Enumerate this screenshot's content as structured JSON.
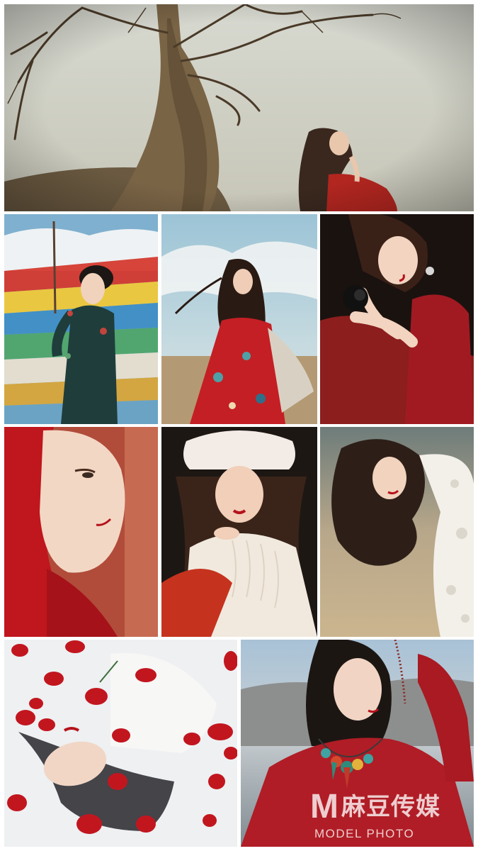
{
  "collage": {
    "photos": [
      {
        "subject": "Woman in red dress leaning back beside a bare twisted tree under an overcast sky"
      },
      {
        "subject": "Woman in dark green embroidered dress in front of colorful prayer flags"
      },
      {
        "subject": "Woman in red floral dress with windblown hair on a grassland under blue sky"
      },
      {
        "subject": "Woman in red sequined dress holding a dark rose"
      },
      {
        "subject": "Close-up profile of a woman wearing a red headscarf"
      },
      {
        "subject": "Woman in white fur hat and cream knit sweater with red scarf"
      },
      {
        "subject": "Woman with curled ponytail in white lace dress, outdoors"
      },
      {
        "subject": "Woman lying in milky water surrounded by red rose petals"
      },
      {
        "subject": "Woman in red top with beaded necklace against distant mountains"
      }
    ]
  },
  "watermark": {
    "logo_letter": "M",
    "logo_text": "麻豆传媒",
    "tagline": "MODEL PHOTO"
  },
  "colors": {
    "background": "#ffffff",
    "red_accent": "#b5121b",
    "sky_blue": "#9fc3d8"
  }
}
